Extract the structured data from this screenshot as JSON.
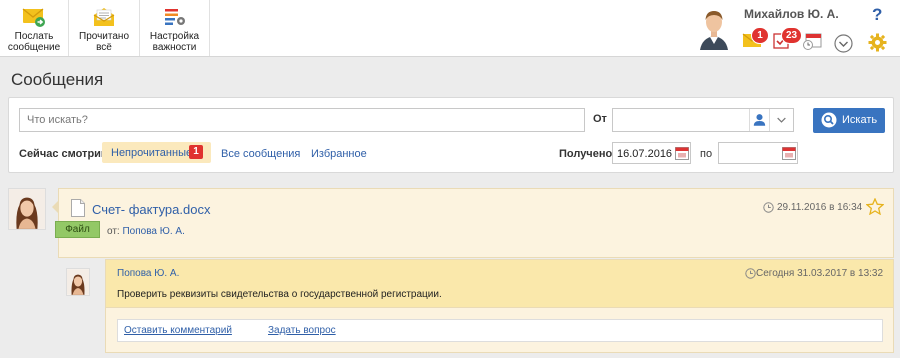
{
  "toolbar": {
    "send_label_1": "Послать",
    "send_label_2": "сообщение",
    "read_label_1": "Прочитано",
    "read_label_2": "всё",
    "importance_label_1": "Настройка",
    "importance_label_2": "важности"
  },
  "user": {
    "name": "Михайлов Ю. А.",
    "mail_count": "1",
    "tasks_count": "23",
    "help": "?"
  },
  "page": {
    "title": "Сообщения"
  },
  "search": {
    "placeholder": "Что искать?",
    "from_label": "От",
    "button_label": "Искать",
    "now_watching_label": "Сейчас смотрим",
    "filters": [
      {
        "label": "Непрочитанные",
        "count": "1"
      },
      {
        "label": "Все сообщения"
      },
      {
        "label": "Избранное"
      }
    ],
    "received_label": "Получено",
    "date_from": "16.07.2016",
    "to_label": "по",
    "date_to": ""
  },
  "message": {
    "title": "Счет- фактура.docx",
    "file_tag": "Файл",
    "from_prefix": "от:",
    "from_name": "Попова Ю. А.",
    "date": "29.11.2016 в 16:34"
  },
  "reply": {
    "author": "Попова Ю. А.",
    "date": "Сегодня 31.03.2017 в 13:32",
    "text": "Проверить реквизиты свидетельства о государственной регистрации.",
    "comment_link": "Оставить комментарий",
    "question_link": "Задать вопрос"
  },
  "colors": {
    "accent": "#3974c0",
    "link": "#2f5fa8",
    "badge": "#e0332f",
    "card_bg": "#fcf3df",
    "reply_head_bg": "#fae8ab",
    "file_tag": "#93c866"
  }
}
